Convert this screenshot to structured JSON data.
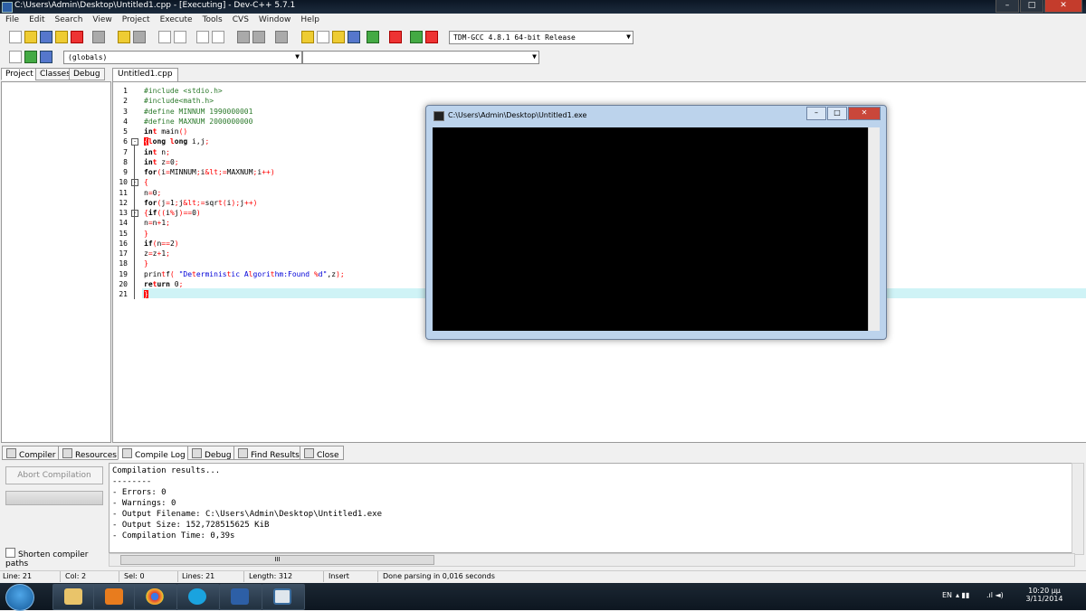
{
  "window": {
    "title": "C:\\Users\\Admin\\Desktop\\Untitled1.cpp - [Executing] - Dev-C++ 5.7.1",
    "controls": [
      "–",
      "□",
      "✕"
    ]
  },
  "menu": [
    "File",
    "Edit",
    "Search",
    "View",
    "Project",
    "Execute",
    "Tools",
    "CVS",
    "Window",
    "Help"
  ],
  "toolbar": {
    "compiler_select": "TDM-GCC 4.8.1 64-bit Release",
    "scope_select": "(globals)",
    "member_select": ""
  },
  "left_tabs": [
    "Project",
    "Classes",
    "Debug"
  ],
  "editor": {
    "tab": "Untitled1.cpp",
    "lines": [
      {
        "n": "1",
        "text": "#include <stdio.h>"
      },
      {
        "n": "2",
        "text": "#include<math.h>"
      },
      {
        "n": "3",
        "text": "#define MINNUM 1990000001"
      },
      {
        "n": "4",
        "text": "#define MAXNUM 2000000000"
      },
      {
        "n": "5",
        "text": "int main()"
      },
      {
        "n": "6",
        "text": "{long long i,j;"
      },
      {
        "n": "7",
        "text": "int n;"
      },
      {
        "n": "8",
        "text": "int z=0;"
      },
      {
        "n": "9",
        "text": "for(i=MINNUM;i<=MAXNUM;i++)"
      },
      {
        "n": "10",
        "text": "{"
      },
      {
        "n": "11",
        "text": "n=0;"
      },
      {
        "n": "12",
        "text": "for(j=1;j<=sqrt(i);j++)"
      },
      {
        "n": "13",
        "text": "{if((i%j)==0)"
      },
      {
        "n": "14",
        "text": "n=n+1;"
      },
      {
        "n": "15",
        "text": "}"
      },
      {
        "n": "16",
        "text": "if(n==2)"
      },
      {
        "n": "17",
        "text": "z=z+1;"
      },
      {
        "n": "18",
        "text": "}"
      },
      {
        "n": "19",
        "text": "printf( \"Deterministic Algorithm:Found %d\",z);"
      },
      {
        "n": "20",
        "text": "return 0;"
      },
      {
        "n": "21",
        "text": "}"
      }
    ]
  },
  "console": {
    "title": "C:\\Users\\Admin\\Desktop\\Untitled1.exe"
  },
  "bottom_tabs": [
    "Compiler",
    "Resources",
    "Compile Log",
    "Debug",
    "Find Results",
    "Close"
  ],
  "compile": {
    "abort_label": "Abort Compilation",
    "shorten_label": "Shorten compiler paths",
    "log": [
      "Compilation results...",
      "--------",
      "- Errors: 0",
      "- Warnings: 0",
      "- Output Filename: C:\\Users\\Admin\\Desktop\\Untitled1.exe",
      "- Output Size: 152,728515625 KiB",
      "- Compilation Time: 0,39s"
    ],
    "hscroll_grip": "III"
  },
  "status": {
    "line": "Line:   21",
    "col": "Col:    2",
    "sel": "Sel:    0",
    "lines": "Lines:   21",
    "length": "Length:  312",
    "mode": "Insert",
    "message": "Done parsing in 0,016 seconds"
  },
  "taskbar": {
    "lang": "EN",
    "time": "10:20 μμ",
    "date": "3/11/2014"
  },
  "colors": {
    "current_line": "#cff3f6",
    "brace_highlight": "#ff0000",
    "preprocessor": "#2c7a2c"
  }
}
